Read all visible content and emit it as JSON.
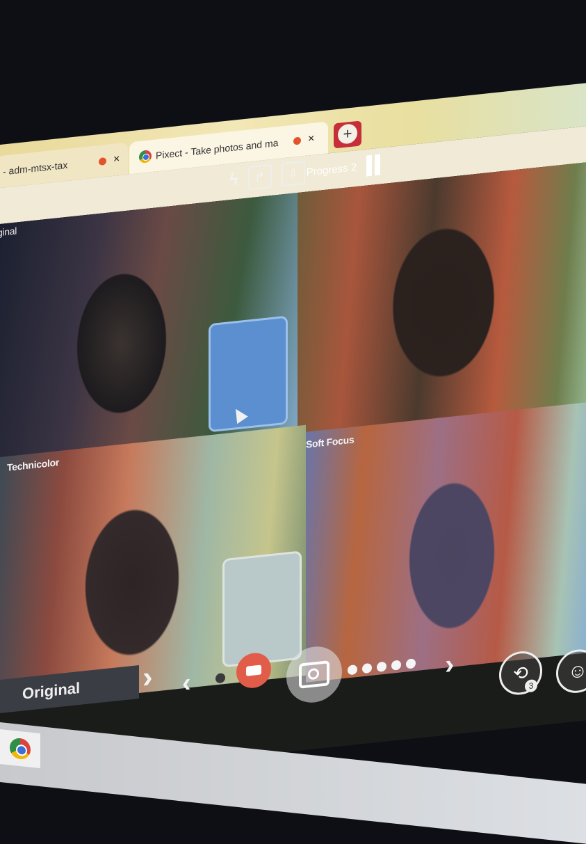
{
  "browser": {
    "tabs": [
      {
        "title": "- adm-mtsx-tax",
        "active": false
      },
      {
        "title": "Pixect - Take photos and ma",
        "active": true
      }
    ],
    "new_tab_symbol": "+",
    "close_symbol": "×"
  },
  "app": {
    "top_controls": {
      "flash_icon": "flash-icon",
      "share_icon": "share-icon",
      "download_icon": "download-icon",
      "progress_text": "Progress 2",
      "pause_icon": "pause-icon"
    },
    "panels": [
      {
        "label": "ginal"
      },
      {
        "label": ""
      },
      {
        "label": "Technicolor"
      },
      {
        "label": "Soft Focus"
      }
    ],
    "bottom": {
      "current_filter": "Original",
      "next_filter_symbol": "›",
      "prev_symbol": "‹",
      "next_symbol": "›",
      "timer_badge": "3"
    }
  },
  "colors": {
    "record_button": "#e25c4a",
    "tab_new_bg": "#c62f3a",
    "rec_dot": "#e2532c"
  }
}
